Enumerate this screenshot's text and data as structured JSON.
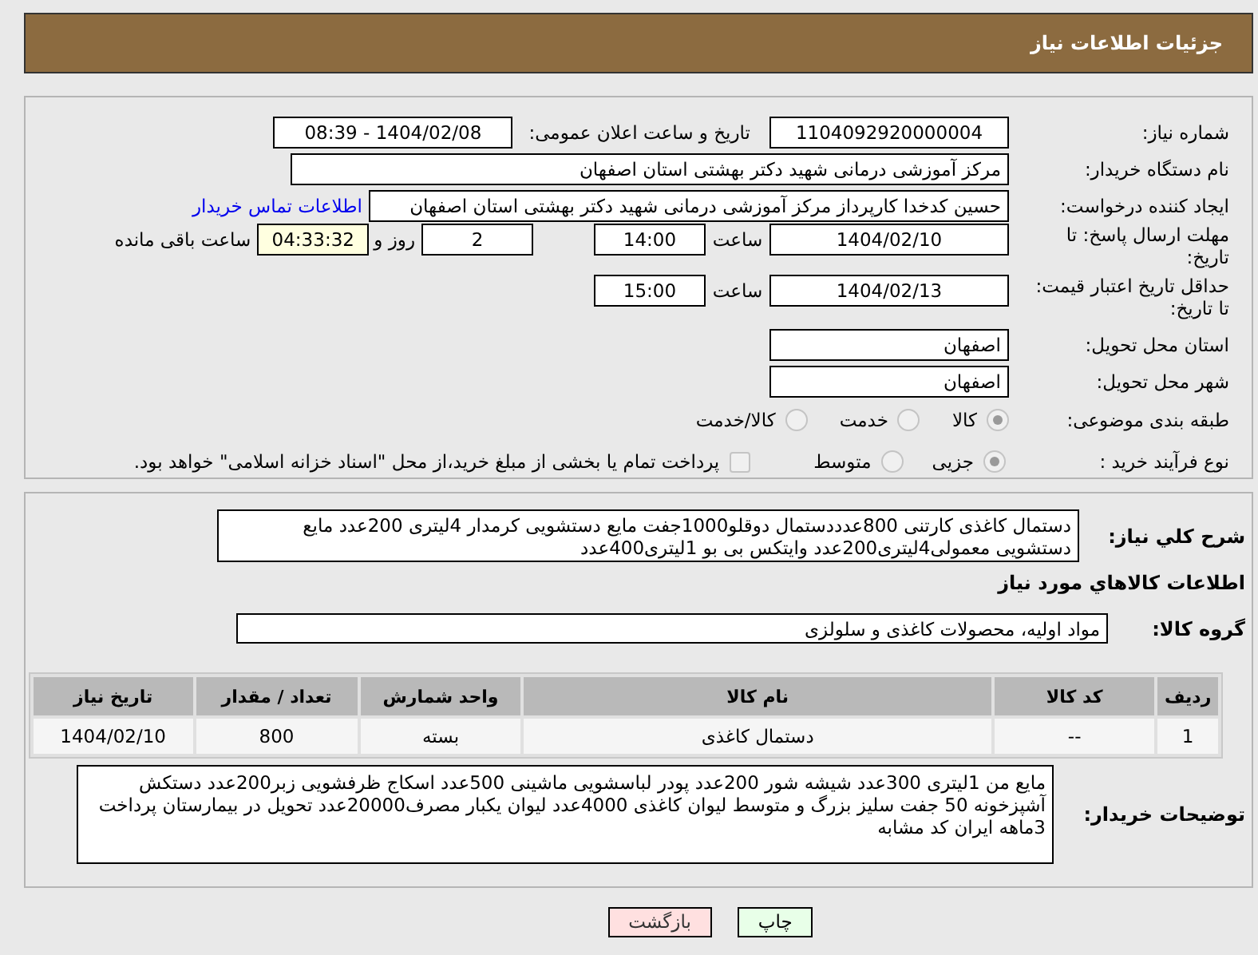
{
  "header": {
    "title": "جزئیات اطلاعات نیاز"
  },
  "need_number": {
    "label": "شماره نیاز:",
    "value": "1104092920000004"
  },
  "announce": {
    "label": "تاریخ و ساعت اعلان عمومی:",
    "value": "1404/02/08 - 08:39"
  },
  "buyer_org": {
    "label": "نام دستگاه خریدار:",
    "value": "مرکز آموزشی درمانی شهید دکتر بهشتی استان اصفهان"
  },
  "requester": {
    "label": "ایجاد کننده درخواست:",
    "value": "حسین کدخدا کارپرداز مرکز آموزشی درمانی شهید دکتر بهشتی استان اصفهان",
    "link": "اطلاعات تماس خریدار"
  },
  "deadline": {
    "label": "مهلت ارسال پاسخ: تا تاریخ:",
    "date": "1404/02/10",
    "time_label": "ساعت",
    "time": "14:00",
    "days": "2",
    "days_label": "روز و",
    "remaining": "04:33:32",
    "remaining_label": "ساعت باقی مانده"
  },
  "price_validity": {
    "label": "حداقل تاریخ اعتبار قیمت: تا تاریخ:",
    "date": "1404/02/13",
    "time_label": "ساعت",
    "time": "15:00"
  },
  "province": {
    "label": "استان محل تحویل:",
    "value": "اصفهان"
  },
  "city": {
    "label": "شهر محل تحویل:",
    "value": "اصفهان"
  },
  "category": {
    "label": "طبقه بندی موضوعی:",
    "options": [
      {
        "label": "کالا",
        "selected": true
      },
      {
        "label": "خدمت",
        "selected": false
      },
      {
        "label": "کالا/خدمت",
        "selected": false
      }
    ]
  },
  "process": {
    "label": "نوع فرآیند خرید :",
    "options": [
      {
        "label": "جزیی",
        "selected": true
      },
      {
        "label": "متوسط",
        "selected": false
      }
    ],
    "payment": {
      "label": "پرداخت تمام یا بخشی از مبلغ خرید،از محل \"اسناد خزانه اسلامی\" خواهد بود.",
      "checked": false
    }
  },
  "description": {
    "label": "شرح کلي نياز:",
    "value": "دستمال کاغذی کارتنی 800عدددستمال دوقلو1000جفت مایع دستشویی کرمدار 4لیتری 200عدد مایع دستشویی معمولی4لیتری200عدد وایتکس بی بو 1لیتری400عدد"
  },
  "goods_heading": "اطلاعات کالاهاي مورد نياز",
  "goods_group": {
    "label": "گروه کالا:",
    "value": "مواد اولیه، محصولات کاغذی و سلولزی"
  },
  "table": {
    "columns": [
      "ردیف",
      "کد کالا",
      "نام کالا",
      "واحد شمارش",
      "تعداد / مقدار",
      "تاریخ نیاز"
    ],
    "rows": [
      [
        "1",
        "--",
        "دستمال کاغذی",
        "بسته",
        "800",
        "1404/02/10"
      ]
    ]
  },
  "buyer_notes": {
    "label": "توضیحات خریدار:",
    "value": "مایع من 1لیتری 300عدد شیشه شور 200عدد پودر لباسشویی ماشینی 500عدد اسکاج ظرفشویی زبر200عدد دستکش آشپزخونه 50 جفت سلیز بزرگ و متوسط لیوان کاغذی 4000عدد لیوان یکبار مصرف20000عدد تحویل در بیمارستان پرداخت 3ماهه ایران کد مشابه"
  },
  "buttons": [
    {
      "label": "چاپ",
      "kind": "print"
    },
    {
      "label": "بازگشت",
      "kind": "back"
    }
  ]
}
